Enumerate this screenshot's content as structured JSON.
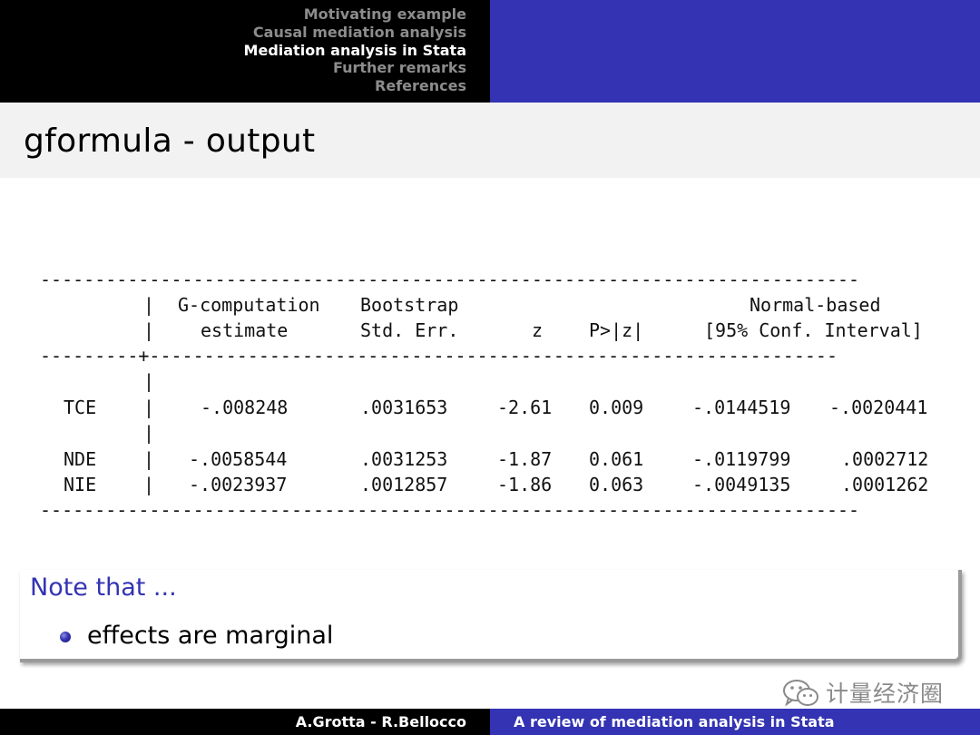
{
  "header": {
    "nav": [
      {
        "label": "Motivating example",
        "active": false
      },
      {
        "label": "Causal mediation analysis",
        "active": false
      },
      {
        "label": "Mediation analysis in Stata",
        "active": true
      },
      {
        "label": "Further remarks",
        "active": false
      },
      {
        "label": "References",
        "active": false
      }
    ]
  },
  "slide": {
    "title": "gformula - output"
  },
  "table": {
    "top_rule": "---------------------------------------------------------------------------",
    "mid_rule": "---------+---------------------------------------------------------------",
    "bottom_rule": "---------------------------------------------------------------------------",
    "pipe": "|",
    "header": {
      "col1_line1": "G-computation",
      "col1_line2": "estimate",
      "col2_line1": "Bootstrap",
      "col2_line2": "Std. Err.",
      "col3": "z",
      "col4": "P>|z|",
      "col5_line1": "Normal-based",
      "col5_line2": "[95% Conf. Interval]"
    },
    "rows": [
      {
        "label": "TCE",
        "estimate": "-.008248",
        "se": ".0031653",
        "z": "-2.61",
        "p": "0.009",
        "lo": "-.0144519",
        "hi": "-.0020441"
      },
      {
        "label": "NDE",
        "estimate": "-.0058544",
        "se": ".0031253",
        "z": "-1.87",
        "p": "0.061",
        "lo": "-.0119799",
        "hi": ".0002712"
      },
      {
        "label": "NIE",
        "estimate": "-.0023937",
        "se": ".0012857",
        "z": "-1.86",
        "p": "0.063",
        "lo": "-.0049135",
        "hi": ".0001262"
      }
    ]
  },
  "note": {
    "title": "Note that ...",
    "bullet": "effects are marginal"
  },
  "watermark": {
    "text": "计量经济圈",
    "icon": "wechat-icon"
  },
  "footer": {
    "authors": "A.Grotta - R.Bellocco",
    "talk_title": "A review of mediation analysis in Stata"
  },
  "colors": {
    "accent": "#3333b3",
    "header_dark": "#000000",
    "title_bg": "#f2f2f2"
  }
}
